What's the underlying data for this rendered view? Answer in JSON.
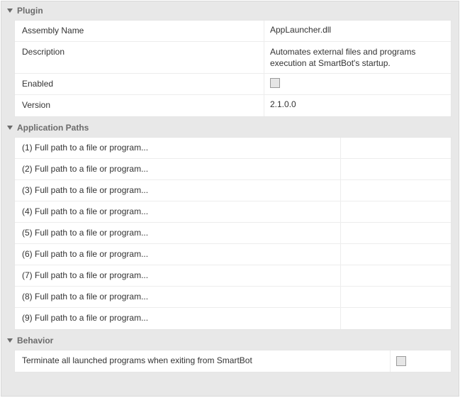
{
  "groups": {
    "plugin": {
      "title": "Plugin",
      "rows": [
        {
          "label": "Assembly Name",
          "value": "AppLauncher.dll"
        },
        {
          "label": "Description",
          "value": "Automates external files and programs execution at SmartBot's startup."
        },
        {
          "label": "Enabled",
          "checkbox": true,
          "checked": false
        },
        {
          "label": "Version",
          "value": "2.1.0.0"
        }
      ]
    },
    "paths": {
      "title": "Application Paths",
      "rows": [
        {
          "label": "(1) Full path to a file or program..."
        },
        {
          "label": "(2) Full path to a file or program..."
        },
        {
          "label": "(3) Full path to a file or program..."
        },
        {
          "label": "(4) Full path to a file or program..."
        },
        {
          "label": "(5) Full path to a file or program..."
        },
        {
          "label": "(6) Full path to a file or program..."
        },
        {
          "label": "(7) Full path to a file or program..."
        },
        {
          "label": "(8) Full path to a file or program..."
        },
        {
          "label": "(9) Full path to a file or program..."
        }
      ]
    },
    "behavior": {
      "title": "Behavior",
      "rows": [
        {
          "label": "Terminate all launched programs when exiting from SmartBot",
          "checkbox": true,
          "checked": false
        }
      ]
    }
  }
}
